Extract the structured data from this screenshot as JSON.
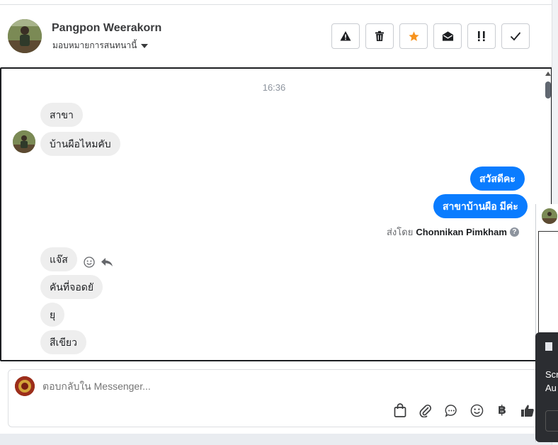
{
  "header": {
    "name": "Pangpon Weerakorn",
    "assign_label": "มอบหมายการสนทนานี้",
    "actions": [
      {
        "icon": "warning-icon"
      },
      {
        "icon": "trash-icon"
      },
      {
        "icon": "star-icon",
        "color": "#f7931e"
      },
      {
        "icon": "mark-unread-icon"
      },
      {
        "icon": "follow-up-icon"
      },
      {
        "icon": "done-check-icon"
      }
    ]
  },
  "conversation": {
    "timestamp": "16:36",
    "incoming_top": [
      "สาขา",
      "บ้านผือไหมคับ"
    ],
    "outgoing": [
      "สวัสดีคะ",
      "สาขาบ้านผือ มีค่ะ"
    ],
    "sent_by_prefix": "ส่งโดย",
    "sent_by_name": "Chonnikan Pimkham",
    "incoming_bottom": [
      "แจ๊ส",
      "คันที่จอดยั",
      "ยุ",
      "สีเขียว"
    ]
  },
  "reply": {
    "placeholder": "ตอบกลับใน Messenger...",
    "currency_symbol": "฿"
  },
  "side_panel": {
    "line1": "Scr",
    "line2": "Au"
  },
  "colors": {
    "outgoing_bubble": "#0a7cff",
    "incoming_bubble": "#eeeeee",
    "star": "#f7931e"
  }
}
